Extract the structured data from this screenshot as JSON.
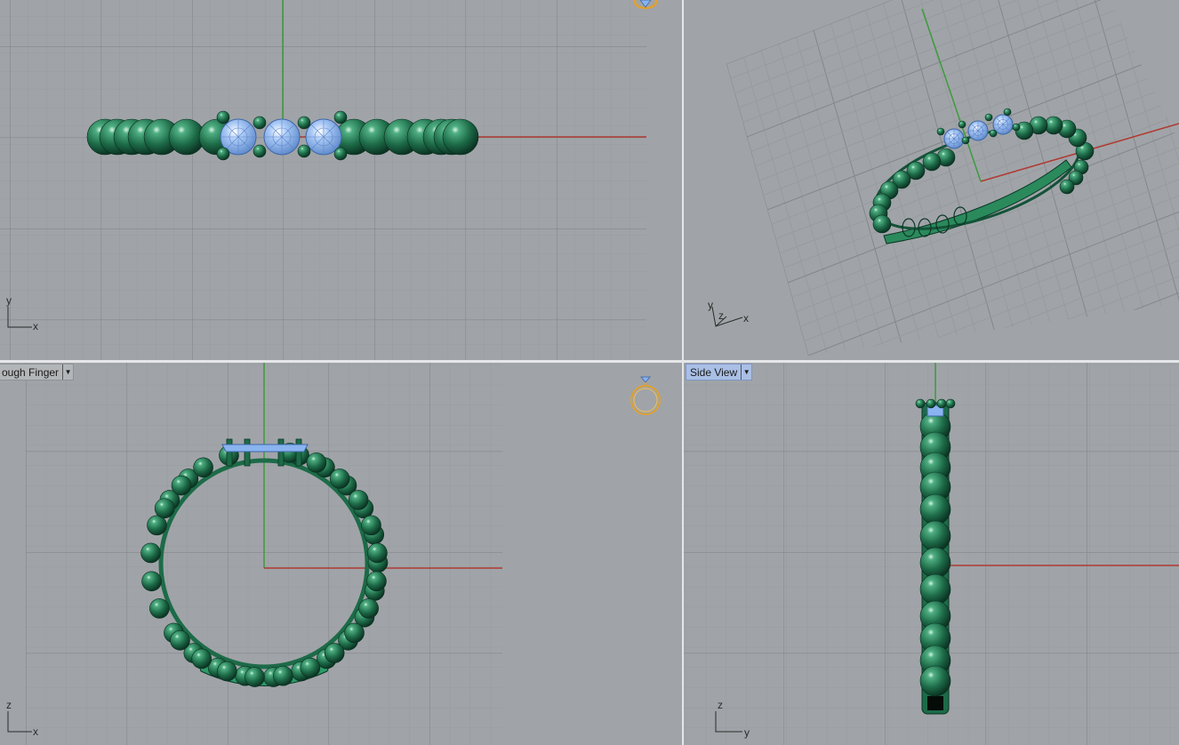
{
  "viewports": {
    "top": {
      "axis_x": "x",
      "axis_y": "y"
    },
    "perspective": {
      "axis_x": "x",
      "axis_y": "y",
      "axis_z": "z"
    },
    "front": {
      "title": "ough Finger",
      "axis_x": "x",
      "axis_z": "z"
    },
    "side": {
      "title": "Side View",
      "axis_y": "y",
      "axis_z": "z"
    }
  },
  "colors": {
    "background": "#a0a4a8",
    "grid_minor": "#969a9e",
    "grid_major": "#84888c",
    "axis_x": "#b03a32",
    "axis_y": "#3e9a3e",
    "metal": "#1e6e4a",
    "gem": "#8ab4f0",
    "ring_icon": "#e0a030"
  },
  "icons": [
    "ring-gem-icon",
    "dropdown-arrow-icon",
    "axis-tripod-icon"
  ]
}
